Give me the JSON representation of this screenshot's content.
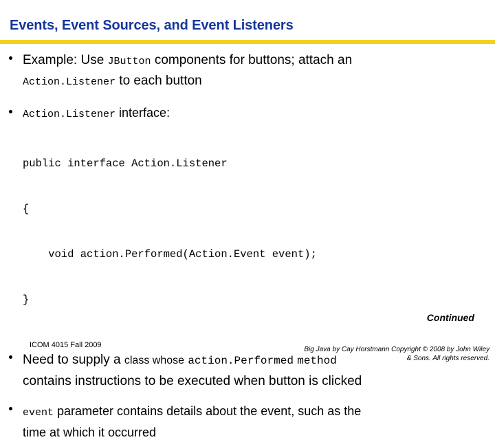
{
  "slide": {
    "title": "Events, Event Sources, and Event Listeners",
    "accent_color": "#f2d024",
    "title_color": "#15369b"
  },
  "bullets": {
    "b1": {
      "p1": "Example: Use ",
      "code1": "JButton",
      "p2": " components for buttons; attach an",
      "code2": "Action.Listener",
      "p3": " to each button"
    },
    "b2": {
      "code1": "Action.Listener",
      "p1": " interface:"
    },
    "b3": {
      "p1": "Need to supply a ",
      "small1": "class whose",
      "code1": "action.Performed",
      "code2": "method",
      "p2": "contains instructions to be executed when button is clicked"
    },
    "b4": {
      "code1": "event",
      "p1": " parameter contains details about the event, such as the",
      "p2": "time at which it occurred"
    }
  },
  "code_block": {
    "line1": "public interface Action.Listener",
    "line2": "{",
    "line3": "    void action.Performed(Action.Event event);",
    "line4": "}"
  },
  "continued": "Continued",
  "footer": {
    "left": "ICOM 4015 Fall 2009",
    "right_line1": "Big Java by Cay Horstmann Copyright © 2008 by John Wiley",
    "right_line2": "& Sons.  All rights reserved."
  }
}
